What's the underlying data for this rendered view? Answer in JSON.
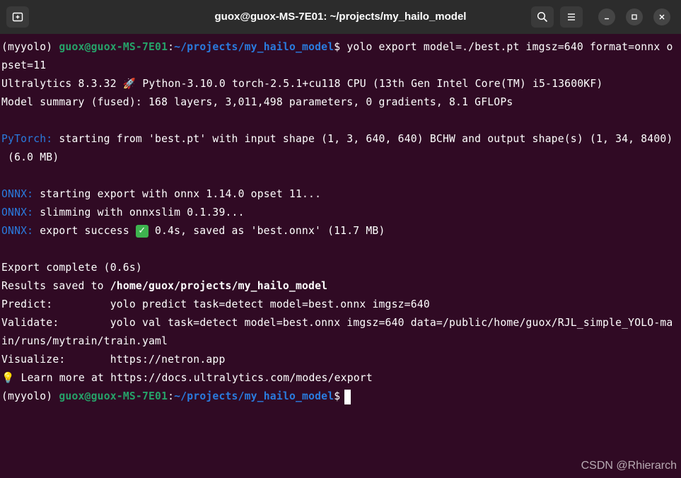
{
  "window": {
    "title": "guox@guox-MS-7E01: ~/projects/my_hailo_model",
    "icons": {
      "new_tab": "new-tab-icon",
      "search": "search-icon",
      "menu": "hamburger-menu-icon",
      "minimize": "minimize-icon",
      "maximize": "maximize-icon",
      "close": "close-icon"
    }
  },
  "prompt": {
    "env": "(myyolo) ",
    "user_host": "guox@guox-MS-7E01",
    "colon": ":",
    "path": "~/projects/my_hailo_model",
    "dollar": "$"
  },
  "lines": {
    "cmd1": " yolo export model=./best.pt imgsz=640 format=onnx o",
    "cmd1_wrap": "pset=11",
    "ultralytics_pre": "Ultralytics 8.3.32 ",
    "ultralytics_post": " Python-3.10.0 torch-2.5.1+cu118 CPU (13th Gen Intel Core(TM) i5-13600KF)",
    "model_summary": "Model summary (fused): 168 layers, 3,011,498 parameters, 0 gradients, 8.1 GFLOPs",
    "pytorch_tag": "PyTorch:",
    "pytorch_text": " starting from 'best.pt' with input shape (1, 3, 640, 640) BCHW and output shape(s) (1, 34, 8400)",
    "pytorch_wrap": " (6.0 MB)",
    "onnx_tag": "ONNX:",
    "onnx1": " starting export with onnx 1.14.0 opset 11...",
    "onnx2": " slimming with onnxslim 0.1.39...",
    "onnx3_pre": " export success ",
    "onnx3_post": " 0.4s, saved as 'best.onnx' (11.7 MB)",
    "export_complete": "Export complete (0.6s)",
    "results_pre": "Results saved to ",
    "results_path": "/home/guox/projects/my_hailo_model",
    "predict": "Predict:         yolo predict task=detect model=best.onnx imgsz=640",
    "validate": "Validate:        yolo val task=detect model=best.onnx imgsz=640 data=/public/home/guox/RJL_simple_YOLO-ma",
    "validate_wrap": "in/runs/mytrain/train.yaml",
    "visualize": "Visualize:       https://netron.app",
    "learn_post": " Learn more at https://docs.ultralytics.com/modes/export"
  },
  "glyphs": {
    "rocket": "🚀",
    "check": "✓",
    "bulb": "💡"
  },
  "watermark": "CSDN @Rhierarch",
  "colors": {
    "background": "#300a24",
    "titlebar": "#2c2c2c",
    "prompt_user": "#26a269",
    "prompt_path": "#2a7bde",
    "tag_blue": "#2a7bde"
  }
}
